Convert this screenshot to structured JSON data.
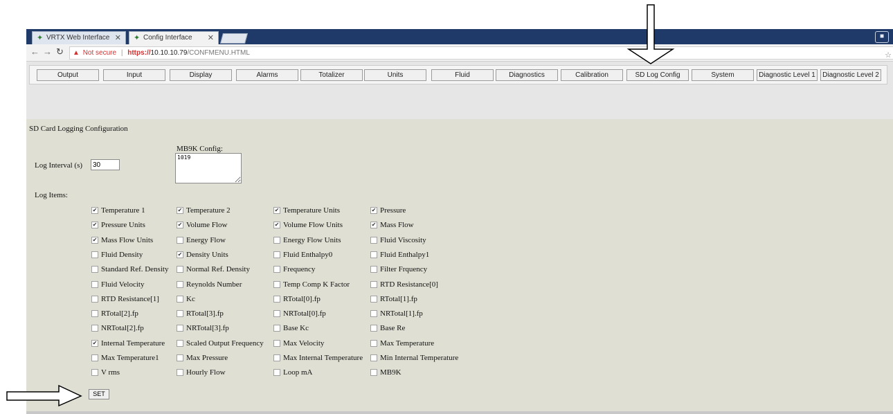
{
  "browser": {
    "tabs": [
      {
        "title": "VRTX Web Interface",
        "active": false
      },
      {
        "title": "Config Interface",
        "active": true
      }
    ],
    "address": {
      "security_text": "Not secure",
      "protocol": "https://",
      "host": "10.10.10.79",
      "path": "/CONFMENU.HTML"
    }
  },
  "menu": [
    "Output",
    "Input",
    "Display",
    "Alarms",
    "Totalizer",
    "Units",
    "Fluid",
    "Diagnostics",
    "Calibration",
    "SD Log Config",
    "System",
    "Diagnostic Level 1",
    "Diagnostic Level 2"
  ],
  "form": {
    "title": "SD Card Logging Configuration",
    "log_interval_label": "Log Interval (s)",
    "log_interval_value": "30",
    "mb9k_label": "MB9K Config:",
    "mb9k_value": "1019",
    "log_items_label": "Log Items:",
    "set_label": "SET"
  },
  "log_items": [
    [
      {
        "label": "Temperature 1",
        "checked": true
      },
      {
        "label": "Temperature 2",
        "checked": true
      },
      {
        "label": "Temperature Units",
        "checked": true
      },
      {
        "label": "Pressure",
        "checked": true
      }
    ],
    [
      {
        "label": "Pressure Units",
        "checked": true
      },
      {
        "label": "Volume Flow",
        "checked": true
      },
      {
        "label": "Volume Flow Units",
        "checked": true
      },
      {
        "label": "Mass Flow",
        "checked": true
      }
    ],
    [
      {
        "label": "Mass Flow Units",
        "checked": true
      },
      {
        "label": "Energy Flow",
        "checked": false
      },
      {
        "label": "Energy Flow Units",
        "checked": false
      },
      {
        "label": "Fluid Viscosity",
        "checked": false
      }
    ],
    [
      {
        "label": "Fluid Density",
        "checked": false
      },
      {
        "label": "Density Units",
        "checked": true
      },
      {
        "label": "Fluid Enthalpy0",
        "checked": false
      },
      {
        "label": "Fluid Enthalpy1",
        "checked": false
      }
    ],
    [
      {
        "label": "Standard Ref. Density",
        "checked": false
      },
      {
        "label": "Normal Ref. Density",
        "checked": false
      },
      {
        "label": "Frequency",
        "checked": false
      },
      {
        "label": "Filter Frquency",
        "checked": false
      }
    ],
    [
      {
        "label": "Fluid Velocity",
        "checked": false
      },
      {
        "label": "Reynolds Number",
        "checked": false
      },
      {
        "label": "Temp Comp K Factor",
        "checked": false
      },
      {
        "label": "RTD Resistance[0]",
        "checked": false
      }
    ],
    [
      {
        "label": "RTD Resistance[1]",
        "checked": false
      },
      {
        "label": "Kc",
        "checked": false
      },
      {
        "label": "RTotal[0].fp",
        "checked": false
      },
      {
        "label": "RTotal[1].fp",
        "checked": false
      }
    ],
    [
      {
        "label": "RTotal[2].fp",
        "checked": false
      },
      {
        "label": "RTotal[3].fp",
        "checked": false
      },
      {
        "label": "NRTotal[0].fp",
        "checked": false
      },
      {
        "label": "NRTotal[1].fp",
        "checked": false
      }
    ],
    [
      {
        "label": "NRTotal[2].fp",
        "checked": false
      },
      {
        "label": "NRTotal[3].fp",
        "checked": false
      },
      {
        "label": "Base Kc",
        "checked": false
      },
      {
        "label": "Base Re",
        "checked": false
      }
    ],
    [
      {
        "label": "Internal Temperature",
        "checked": true
      },
      {
        "label": "Scaled Output Frequency",
        "checked": false
      },
      {
        "label": "Max Velocity",
        "checked": false
      },
      {
        "label": "Max Temperature",
        "checked": false
      }
    ],
    [
      {
        "label": "Max Temperature1",
        "checked": false
      },
      {
        "label": "Max Pressure",
        "checked": false
      },
      {
        "label": "Max Internal Temperature",
        "checked": false
      },
      {
        "label": "Min Internal Temperature",
        "checked": false
      }
    ],
    [
      {
        "label": "V rms",
        "checked": false
      },
      {
        "label": "Hourly Flow",
        "checked": false
      },
      {
        "label": "Loop mA",
        "checked": false
      },
      {
        "label": "MB9K",
        "checked": false
      }
    ]
  ]
}
